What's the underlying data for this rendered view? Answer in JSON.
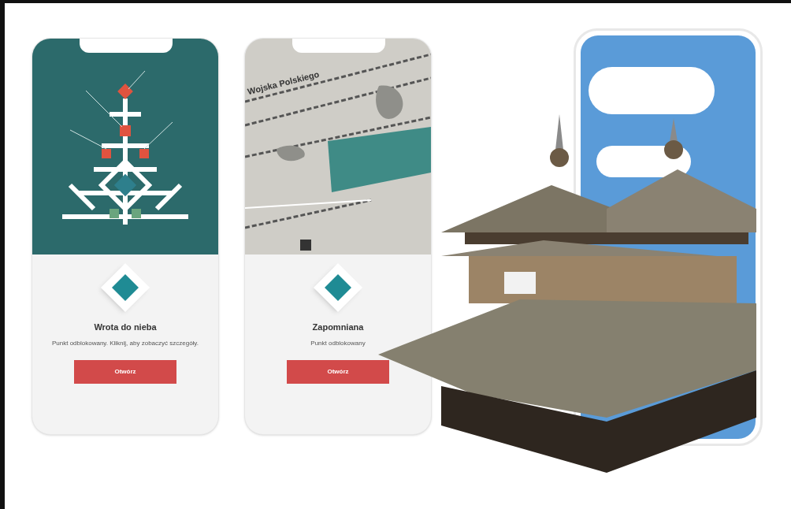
{
  "phones": [
    {
      "kind": "diagram",
      "title": "Wrota do nieba",
      "description": "Punkt odblokowany. Kliknij, aby zobaczyć szczegóły.",
      "button": "Otwórz"
    },
    {
      "kind": "map",
      "map_label": "Wojska Polskiego",
      "title": "Zapomniana",
      "description": "Punkt odblokowany",
      "button": "Otwórz"
    },
    {
      "kind": "photo"
    }
  ]
}
